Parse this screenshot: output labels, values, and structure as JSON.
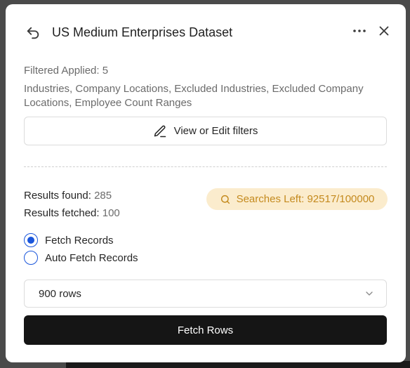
{
  "header": {
    "title": "US Medium Enterprises Dataset"
  },
  "filters": {
    "applied_label": "Filtered Applied: 5",
    "list": "Industries, Company Locations, Excluded Industries, Excluded Company Locations, Employee Count Ranges",
    "edit_button_label": "View or Edit filters"
  },
  "results": {
    "found_label": "Results found:",
    "found_value": "285",
    "fetched_label": "Results fetched:",
    "fetched_value": "100"
  },
  "searches_left": {
    "label": "Searches Left: 92517/100000",
    "color": "#c48a1e",
    "background": "#fbeccd"
  },
  "fetch_mode": {
    "options": [
      "Fetch Records",
      "Auto Fetch Records"
    ],
    "selected": "Fetch Records"
  },
  "rows_select": {
    "value": "900 rows"
  },
  "fetch_button": {
    "label": "Fetch Rows"
  },
  "icons": {
    "back": "undo-arrow-icon",
    "more": "more-horizontal-icon",
    "close": "close-icon",
    "edit": "pencil-icon",
    "search": "search-icon",
    "select": "chevron-down-icon"
  },
  "colors": {
    "accent": "#1a56db",
    "primary_button": "#151515"
  }
}
